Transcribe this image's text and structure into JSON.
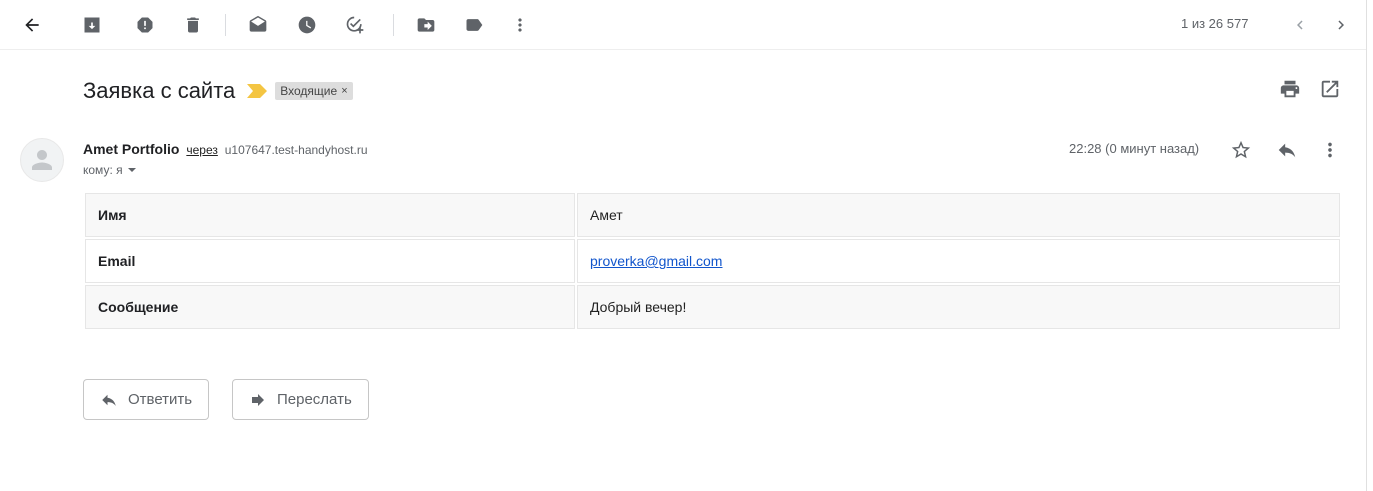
{
  "toolbar": {
    "icons": [
      "back-arrow-icon",
      "archive-icon",
      "report-spam-icon",
      "delete-icon",
      "mark-unread-icon",
      "snooze-icon",
      "add-to-tasks-icon",
      "move-to-icon",
      "labels-icon",
      "more-vert-icon"
    ],
    "counter": "1 из 26 577"
  },
  "message": {
    "subject": "Заявка с сайта",
    "label": "Входящие",
    "label_close": "×",
    "sender_name": "Amet Portfolio",
    "via": "через",
    "via_host": "u107647.test-handyhost.ru",
    "to_line": "кому: я",
    "time": "22:28 (0 минут назад)"
  },
  "table": {
    "rows": [
      {
        "key": "Имя",
        "value": "Амет"
      },
      {
        "key": "Email",
        "value": "proverka@gmail.com"
      },
      {
        "key": "Сообщение",
        "value": "Добрый вечер!"
      }
    ]
  },
  "actions": {
    "reply_label": "Ответить",
    "forward_label": "Переслать"
  },
  "colors": {
    "importance_marker": "#f4c542",
    "label_bg": "#dddddd",
    "link": "#1155cc"
  }
}
